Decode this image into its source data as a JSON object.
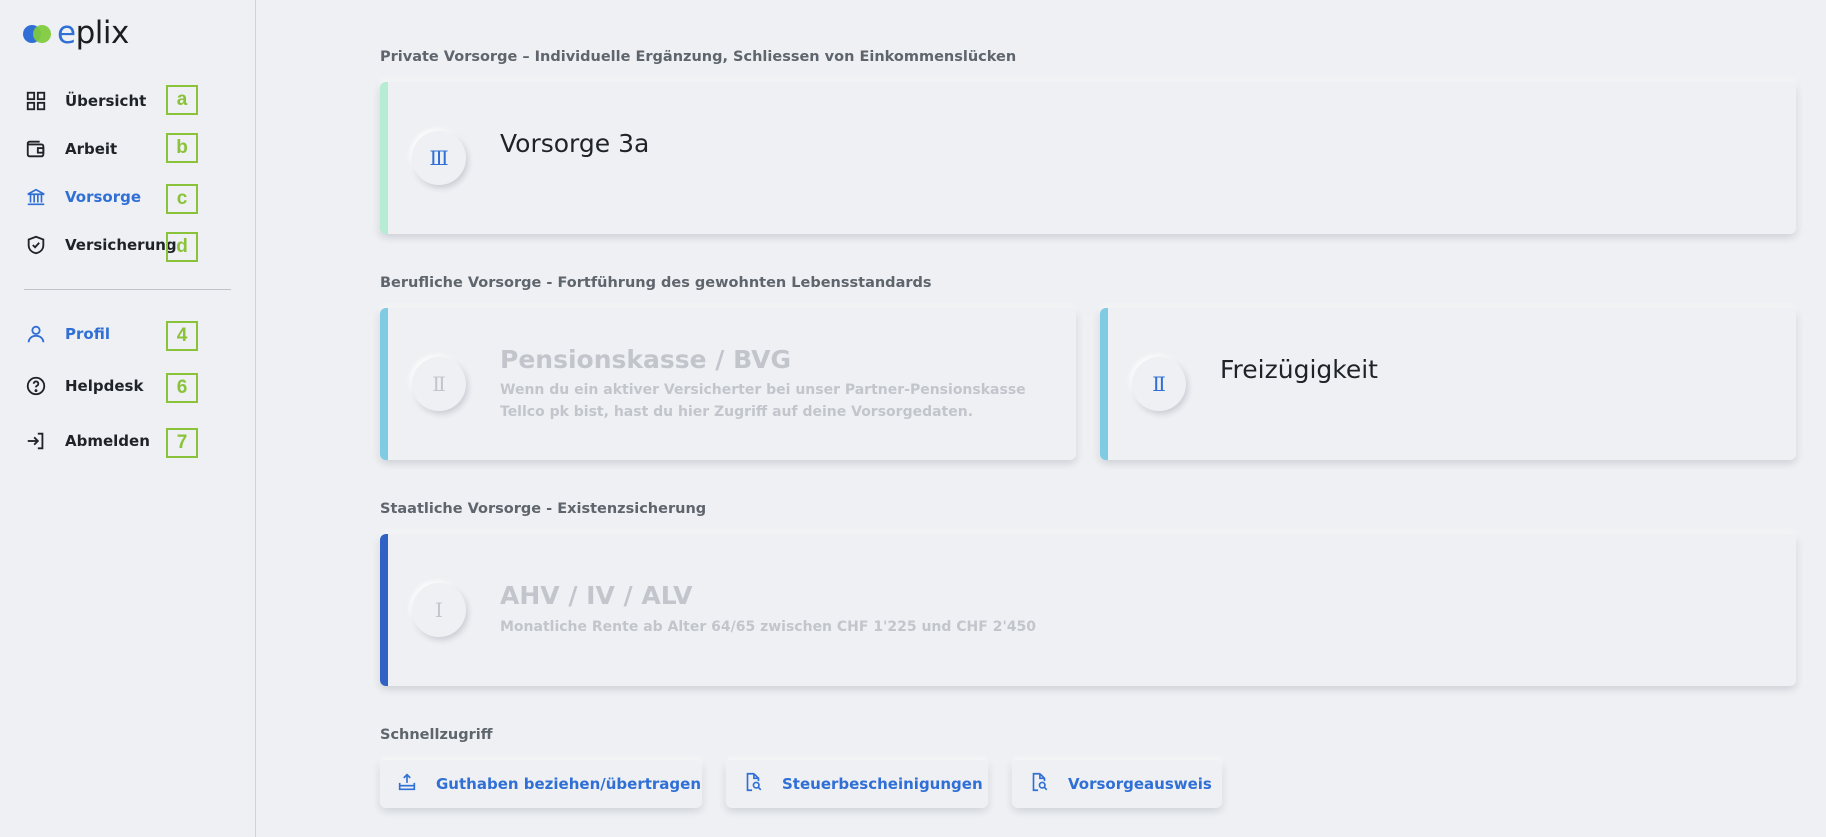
{
  "brand": {
    "name_prefix": "e",
    "name_rest": "plix"
  },
  "sidebar": {
    "items": [
      {
        "label": "Übersicht",
        "icon": "grid-icon",
        "badge": "a"
      },
      {
        "label": "Arbeit",
        "icon": "wallet-icon",
        "badge": "b"
      },
      {
        "label": "Vorsorge",
        "icon": "bank-icon",
        "badge": "c"
      },
      {
        "label": "Versicherung",
        "icon": "shield-check-icon",
        "badge": "d"
      }
    ],
    "secondary": [
      {
        "label": "Profil",
        "icon": "user-icon",
        "badge": "4"
      },
      {
        "label": "Helpdesk",
        "icon": "help-circle-icon",
        "badge": "6"
      },
      {
        "label": "Abmelden",
        "icon": "logout-icon",
        "badge": "7"
      }
    ]
  },
  "sections": {
    "private": {
      "title": "Private Vorsorge – Individuelle Ergänzung, Schliessen von Einkommenslücken",
      "card": {
        "pillar": "Ⅲ",
        "title": "Vorsorge 3a"
      }
    },
    "occupational": {
      "title": "Berufliche Vorsorge - Fortführung des gewohnten Lebensstandards",
      "cards": [
        {
          "pillar": "Ⅱ",
          "title": "Pensionskasse / BVG",
          "description": "Wenn du ein aktiver Versicherter bei unser Partner-Pensionskasse Tellco pk bist, hast du hier Zugriff auf deine Vorsorgedaten."
        },
        {
          "pillar": "Ⅱ",
          "title": "Freizügigkeit"
        }
      ]
    },
    "state": {
      "title": "Staatliche Vorsorge - Existenzsicherung",
      "card": {
        "pillar": "Ⅰ",
        "title": "AHV / IV / ALV",
        "description": "Monatliche Rente ab Alter 64/65 zwischen CHF 1'225 und CHF 2'450"
      }
    }
  },
  "quick_access": {
    "title": "Schnellzugriff",
    "buttons": [
      {
        "label": "Guthaben beziehen/übertragen",
        "icon": "upload-tray-icon"
      },
      {
        "label": "Steuerbescheinigungen",
        "icon": "document-search-icon"
      },
      {
        "label": "Vorsorgeausweis",
        "icon": "document-search-icon"
      }
    ]
  },
  "colors": {
    "accent_blue": "#2f6fd6",
    "badge_green": "#8ac23a",
    "private_accent": "#b6ebd4",
    "occupational_accent": "#7ecbe3",
    "state_accent": "#2f62c4"
  }
}
